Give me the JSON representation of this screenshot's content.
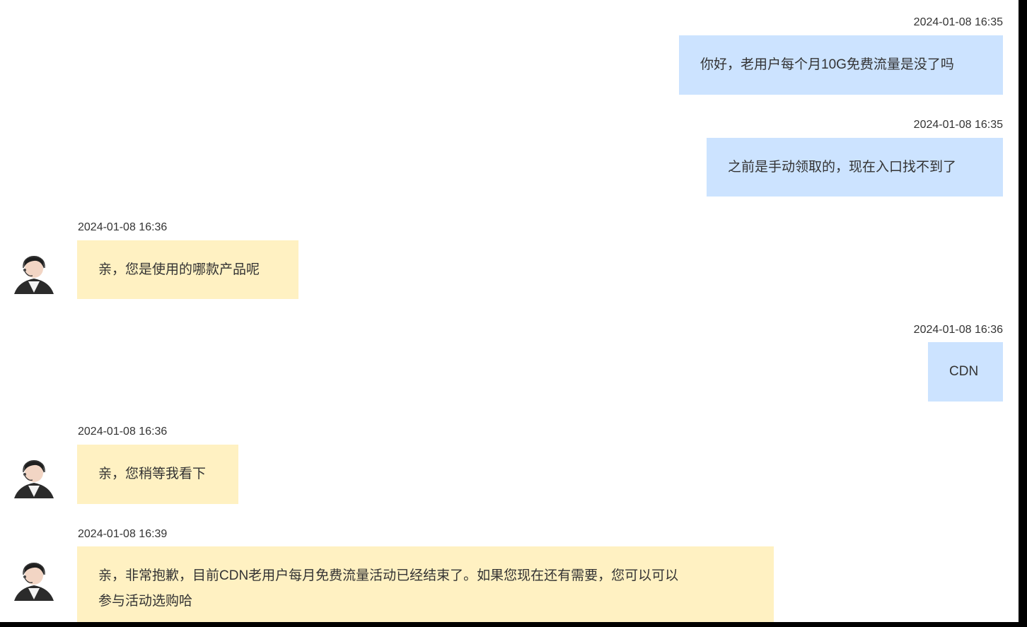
{
  "messages": [
    {
      "sender": "user",
      "time": "2024-01-08 16:35",
      "text": "你好，老用户每个月10G免费流量是没了吗"
    },
    {
      "sender": "user",
      "time": "2024-01-08 16:35",
      "text": "之前是手动领取的，现在入口找不到了"
    },
    {
      "sender": "agent",
      "time": "2024-01-08 16:36",
      "text": "亲，您是使用的哪款产品呢"
    },
    {
      "sender": "user",
      "time": "2024-01-08 16:36",
      "text": "CDN"
    },
    {
      "sender": "agent",
      "time": "2024-01-08 16:36",
      "text": "亲，您稍等我看下"
    },
    {
      "sender": "agent",
      "time": "2024-01-08 16:39",
      "text_line1": "亲，非常抱歉，目前CDN老用户每月免费流量活动已经结束了。如果您现在还有需要，您可以可以",
      "text_line2": "参与活动选购哈"
    }
  ],
  "colors": {
    "user_bubble": "#cce3ff",
    "agent_bubble": "#fff1c2"
  },
  "icons": {
    "agent_avatar": "customer-service-avatar-icon"
  }
}
